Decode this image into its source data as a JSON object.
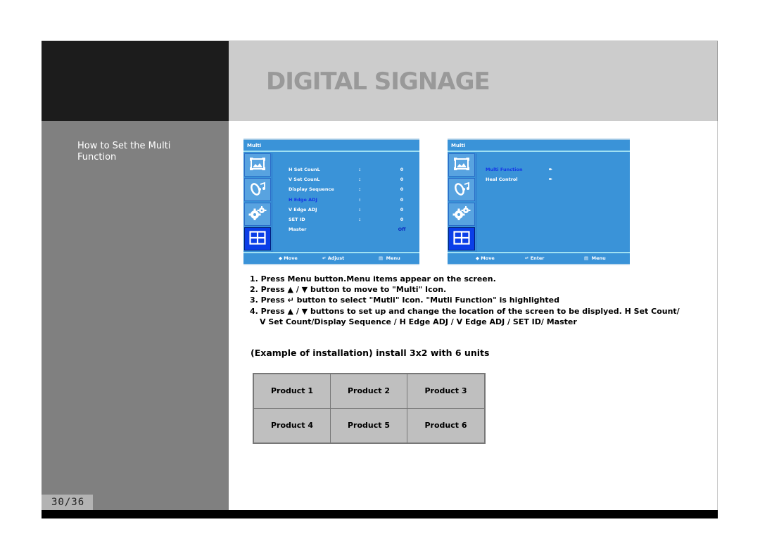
{
  "header": {
    "title": "DIGITAL SIGNAGE"
  },
  "sidebar": {
    "section_title": "How to Set the Multi Function",
    "page_number": "30/36"
  },
  "osd_left": {
    "title": "Multi",
    "icons": [
      "picture-icon",
      "sound-icon",
      "setup-gears-icon",
      "multi-grid-icon"
    ],
    "active_icon": "multi-grid-icon",
    "rows": [
      {
        "label": "H Set CounL",
        "sep": ":",
        "value": "0",
        "highlighted": false
      },
      {
        "label": "V Set CounL",
        "sep": ":",
        "value": "0",
        "highlighted": false
      },
      {
        "label": "Display Sequence",
        "sep": ":",
        "value": "0",
        "highlighted": false
      },
      {
        "label": "H Edge ADJ",
        "sep": ":",
        "value": "0",
        "highlighted": true
      },
      {
        "label": "V Edge ADJ",
        "sep": ":",
        "value": "0",
        "highlighted": false
      },
      {
        "label": "SET ID",
        "sep": ":",
        "value": "0",
        "highlighted": false
      },
      {
        "label": "Master",
        "sep": "",
        "value": "Off",
        "highlighted": false
      }
    ],
    "footer": {
      "move": "Move",
      "action": "Adjust",
      "menu": "Menu"
    }
  },
  "osd_right": {
    "title": "Multi",
    "icons": [
      "picture-icon",
      "sound-icon",
      "setup-gears-icon",
      "multi-grid-icon"
    ],
    "active_icon": "multi-grid-icon",
    "rows": [
      {
        "label": "Multi Function",
        "arrow": "▸▸",
        "highlighted": true
      },
      {
        "label": "Heal Control",
        "arrow": "▸▸",
        "highlighted": false
      }
    ],
    "footer": {
      "move": "Move",
      "action": "Enter",
      "menu": "Menu"
    }
  },
  "instructions": [
    "1. Press Menu button.Menu items appear on the screen.",
    "2. Press ▲ / ▼ button to move to \"Multi\" Icon.",
    "3. Press ↵ button to select \"Mutli\"  Icon. \"Mutli Function\" is highlighted",
    "4. Press ▲ / ▼ buttons to set up and change the location of the screen to be displyed. H Set Count/",
    "V Set Count/Display Sequence / H Edge ADJ / V Edge ADJ / SET ID/ Master"
  ],
  "example": {
    "title": "(Example of installation) install 3x2 with 6 units",
    "products": [
      "Product 1",
      "Product 2",
      "Product 3",
      "Product 4",
      "Product 5",
      "Product 6"
    ]
  },
  "colors": {
    "osd_blue": "#3a93d8",
    "osd_active": "#0a3ee8",
    "highlight_text": "#1537e6",
    "header_band": "#cccccc",
    "sidebar": "#808080"
  }
}
